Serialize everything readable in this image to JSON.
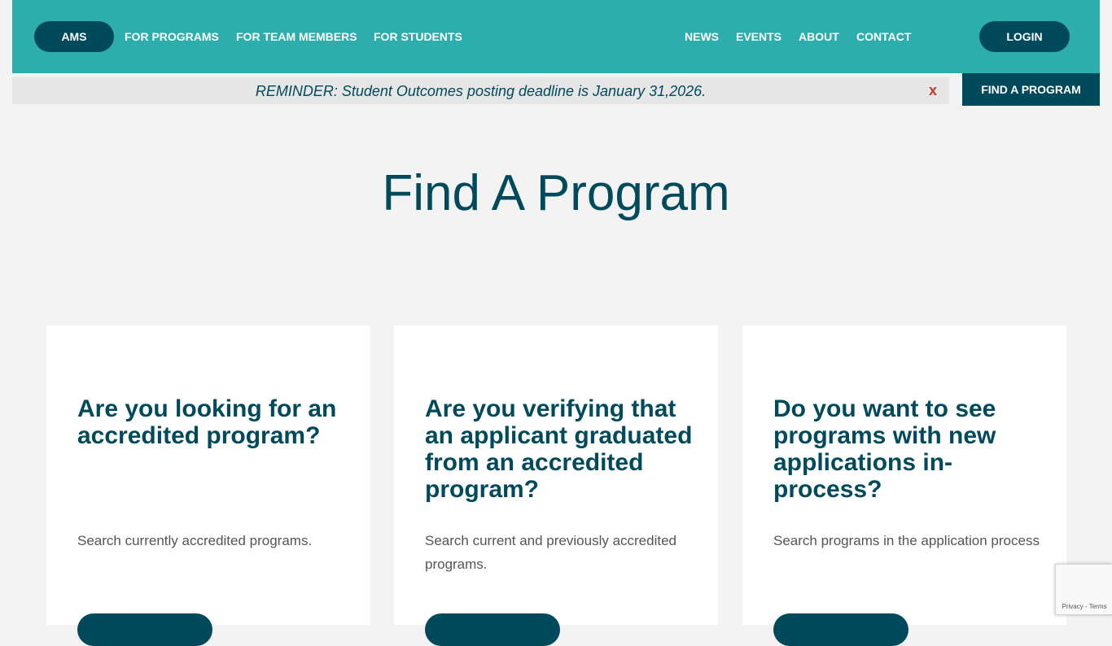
{
  "header": {
    "ams_label": "AMS",
    "nav_left": [
      "FOR PROGRAMS",
      "FOR TEAM MEMBERS",
      "FOR STUDENTS"
    ],
    "nav_right": [
      "NEWS",
      "EVENTS",
      "ABOUT",
      "CONTACT"
    ],
    "login_label": "LOGIN"
  },
  "reminder": {
    "text": "REMINDER: Student Outcomes posting deadline is January 31,2026.",
    "close": "x"
  },
  "find_button_label": "FIND A PROGRAM",
  "page_title": "Find A Program",
  "cards": [
    {
      "heading": "Are you looking for an accredited program?",
      "text": "Search currently accredited programs."
    },
    {
      "heading": "Are you verifying that an applicant graduated from an accredited program?",
      "text": "Search current and previously accredited programs."
    },
    {
      "heading": "Do you want to see programs with new applications in-process?",
      "text": "Search programs in the application process"
    }
  ],
  "recaptcha": {
    "privacy": "Privacy",
    "separator": " - ",
    "terms": "Terms"
  },
  "colors": {
    "header_bg": "#2daeac",
    "primary": "#004a5c",
    "close": "#c0392b",
    "page_bg": "#f3f3f3"
  }
}
